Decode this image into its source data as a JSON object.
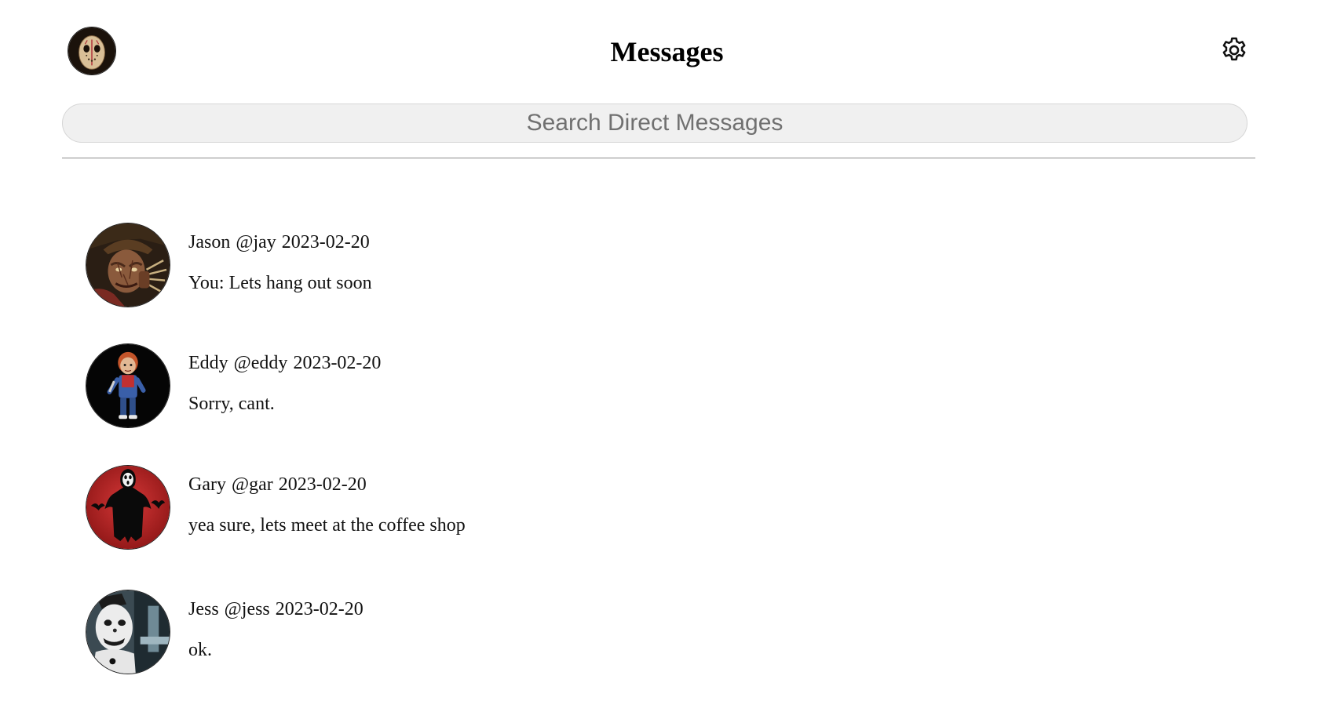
{
  "header": {
    "title": "Messages",
    "profile_avatar_icon": "jason-mask-avatar",
    "settings_icon": "gear-icon"
  },
  "search": {
    "placeholder": "Search Direct Messages",
    "value": ""
  },
  "conversations": [
    {
      "name": "Jason",
      "handle": "@jay",
      "date": "2023-02-20",
      "preview": "You: Lets hang out soon",
      "avatar_icon": "freddy-avatar"
    },
    {
      "name": "Eddy",
      "handle": "@eddy",
      "date": "2023-02-20",
      "preview": "Sorry, cant.",
      "avatar_icon": "chucky-doll-avatar"
    },
    {
      "name": "Gary",
      "handle": "@gar",
      "date": "2023-02-20",
      "preview": "yea sure, lets meet at the coffee shop",
      "avatar_icon": "ghostface-avatar"
    },
    {
      "name": "Jess",
      "handle": "@jess",
      "date": "2023-02-20",
      "preview": "ok.",
      "avatar_icon": "clown-avatar"
    }
  ]
}
